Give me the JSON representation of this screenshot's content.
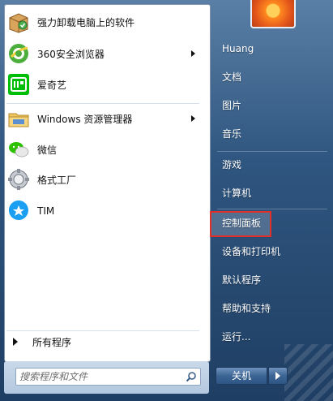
{
  "start_menu": {
    "programs": [
      {
        "label": "强力卸载电脑上的软件",
        "icon": "uninstall-box-icon",
        "has_submenu": false
      },
      {
        "label": "360安全浏览器",
        "icon": "360-browser-icon",
        "has_submenu": true
      },
      {
        "label": "爱奇艺",
        "icon": "iqiyi-icon",
        "has_submenu": false
      },
      {
        "label": "Windows 资源管理器",
        "icon": "explorer-folder-icon",
        "has_submenu": true
      },
      {
        "label": "微信",
        "icon": "wechat-icon",
        "has_submenu": false
      },
      {
        "label": "格式工厂",
        "icon": "format-factory-icon",
        "has_submenu": false
      },
      {
        "label": "TIM",
        "icon": "tim-icon",
        "has_submenu": false
      }
    ],
    "all_programs_label": "所有程序",
    "search": {
      "placeholder": "搜索程序和文件",
      "value": ""
    },
    "right_links": [
      {
        "label": "Huang"
      },
      {
        "label": "文档"
      },
      {
        "label": "图片"
      },
      {
        "label": "音乐"
      },
      {
        "label": "游戏"
      },
      {
        "label": "计算机"
      },
      {
        "label": "控制面板",
        "highlighted": true
      },
      {
        "label": "设备和打印机"
      },
      {
        "label": "默认程序"
      },
      {
        "label": "帮助和支持"
      },
      {
        "label": "运行..."
      }
    ],
    "shutdown_label": "关机",
    "colors": {
      "highlight_box": "#e0302a",
      "panel_blue": "#2f5680"
    }
  }
}
